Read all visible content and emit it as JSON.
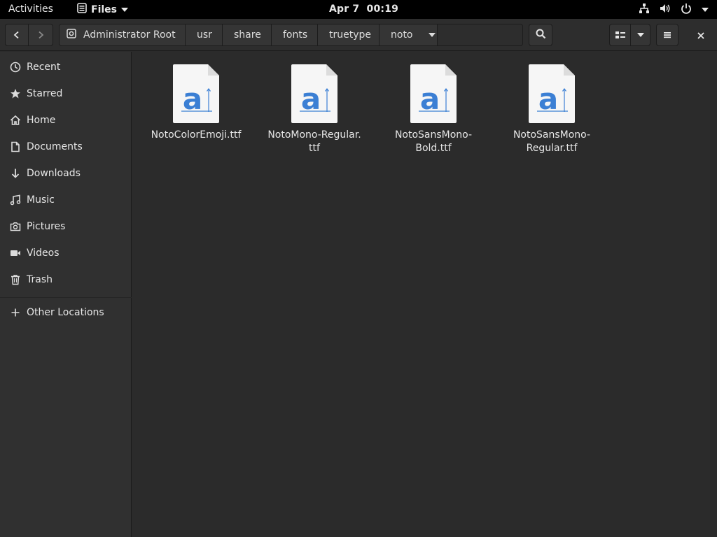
{
  "topbar": {
    "activities": "Activities",
    "app_name": "Files",
    "date": "Apr 7",
    "time": "00:19"
  },
  "headerbar": {
    "path": [
      {
        "label": "Administrator Root"
      },
      {
        "label": "usr"
      },
      {
        "label": "share"
      },
      {
        "label": "fonts"
      },
      {
        "label": "truetype"
      },
      {
        "label": "noto"
      }
    ]
  },
  "sidebar": {
    "items": [
      {
        "label": "Recent",
        "icon": "clock-icon"
      },
      {
        "label": "Starred",
        "icon": "star-icon"
      },
      {
        "label": "Home",
        "icon": "home-icon"
      },
      {
        "label": "Documents",
        "icon": "document-icon"
      },
      {
        "label": "Downloads",
        "icon": "download-icon"
      },
      {
        "label": "Music",
        "icon": "music-icon"
      },
      {
        "label": "Pictures",
        "icon": "camera-icon"
      },
      {
        "label": "Videos",
        "icon": "video-icon"
      },
      {
        "label": "Trash",
        "icon": "trash-icon"
      }
    ],
    "other_locations": "Other Locations"
  },
  "files": [
    {
      "name": "NotoColorEmoji.ttf",
      "icon": "font-file-icon"
    },
    {
      "name": "NotoMono-Regular.\nttf",
      "icon": "font-file-icon"
    },
    {
      "name": "NotoSansMono-\nBold.ttf",
      "icon": "font-file-icon"
    },
    {
      "name": "NotoSansMono-\nRegular.ttf",
      "icon": "font-file-icon"
    }
  ],
  "colors": {
    "accent_blue": "#3b7fd4",
    "topbar_bg": "#000000",
    "sidebar_bg": "#303030",
    "content_bg": "#2b2b2b"
  }
}
